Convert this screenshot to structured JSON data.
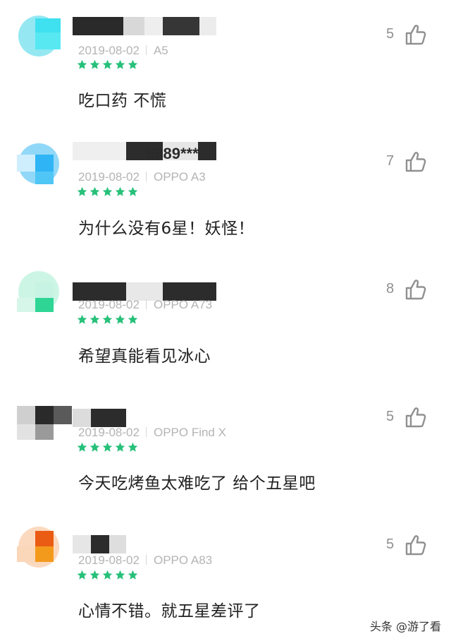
{
  "reviews": [
    {
      "date": "2019-08-02",
      "device": "A5",
      "stars": 5,
      "content": "吃口药  不慌",
      "likes": "5",
      "avatar_color": "#3ed6e8",
      "name_visible": ""
    },
    {
      "date": "2019-08-02",
      "device": "OPPO A3",
      "stars": 5,
      "content": "为什么没有6星！妖怪！",
      "likes": "7",
      "avatar_color": "#36b8f2",
      "name_visible": "6989***"
    },
    {
      "date": "2019-08-02",
      "device": "OPPO A73",
      "stars": 5,
      "content": "希望真能看见冰心",
      "likes": "8",
      "avatar_color": "#2fd595",
      "name_visible": ""
    },
    {
      "date": "2019-08-02",
      "device": "OPPO Find X",
      "stars": 5,
      "content": "今天吃烤鱼太难吃了 给个五星吧",
      "likes": "5",
      "avatar_color": "#444444",
      "name_visible": ""
    },
    {
      "date": "2019-08-02",
      "device": "OPPO A83",
      "stars": 5,
      "content": "心情不错。就五星差评了",
      "likes": "5",
      "avatar_color": "#f07a10",
      "name_visible": ""
    }
  ],
  "star_color": "#27c07a",
  "icons": {
    "like": "thumbs-up-icon",
    "star": "star-icon"
  },
  "watermark": "头条 @游了看"
}
